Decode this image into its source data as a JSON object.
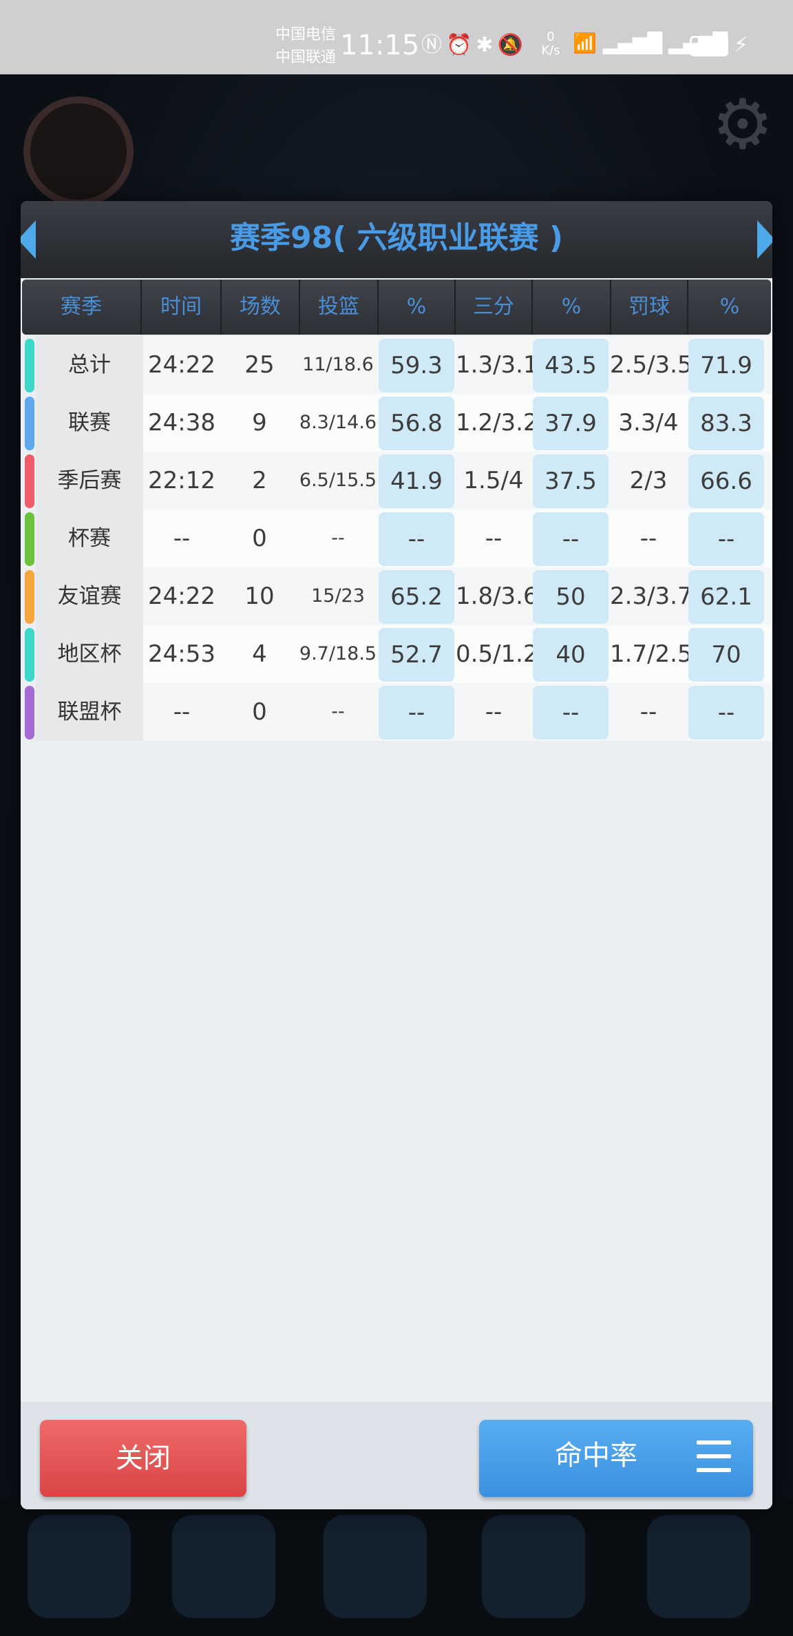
{
  "status_bar": {
    "carrier1": "中国电信",
    "carrier2": "中国联通",
    "time": "11:15",
    "net_speed_value": "0",
    "net_speed_unit": "K/s",
    "battery": "91",
    "icons": [
      "nfc-icon",
      "alarm-icon",
      "bluetooth-icon",
      "mute-icon",
      "wifi-icon",
      "signal-5g-icon",
      "signal-4g-icon",
      "charging-icon"
    ]
  },
  "modal": {
    "title": "赛季98( 六级职业联赛 )",
    "columns": [
      "赛季",
      "时间",
      "场数",
      "投篮",
      "%",
      "三分",
      "%",
      "罚球",
      "%"
    ],
    "rows": [
      {
        "label": "总计",
        "color": "#3ed6c8",
        "time": "24:22",
        "games": "25",
        "fg": "11/18.6",
        "fg_pct": "59.3",
        "three": "1.3/3.1",
        "three_pct": "43.5",
        "ft": "2.5/3.5",
        "ft_pct": "71.9"
      },
      {
        "label": "联赛",
        "color": "#5fa8ee",
        "time": "24:38",
        "games": "9",
        "fg": "8.3/14.6",
        "fg_pct": "56.8",
        "three": "1.2/3.2",
        "three_pct": "37.9",
        "ft": "3.3/4",
        "ft_pct": "83.3"
      },
      {
        "label": "季后赛",
        "color": "#ee5d6a",
        "time": "22:12",
        "games": "2",
        "fg": "6.5/15.5",
        "fg_pct": "41.9",
        "three": "1.5/4",
        "three_pct": "37.5",
        "ft": "2/3",
        "ft_pct": "66.6"
      },
      {
        "label": "杯赛",
        "color": "#6cc23c",
        "time": "--",
        "games": "0",
        "fg": "--",
        "fg_pct": "--",
        "three": "--",
        "three_pct": "--",
        "ft": "--",
        "ft_pct": "--"
      },
      {
        "label": "友谊赛",
        "color": "#f7a53e",
        "time": "24:22",
        "games": "10",
        "fg": "15/23",
        "fg_pct": "65.2",
        "three": "1.8/3.6",
        "three_pct": "50",
        "ft": "2.3/3.7",
        "ft_pct": "62.1"
      },
      {
        "label": "地区杯",
        "color": "#3ed6c8",
        "time": "24:53",
        "games": "4",
        "fg": "9.7/18.5",
        "fg_pct": "52.7",
        "three": "0.5/1.2",
        "three_pct": "40",
        "ft": "1.7/2.5",
        "ft_pct": "70"
      },
      {
        "label": "联盟杯",
        "color": "#a46ad6",
        "time": "--",
        "games": "0",
        "fg": "--",
        "fg_pct": "--",
        "three": "--",
        "three_pct": "--",
        "ft": "--",
        "ft_pct": "--"
      }
    ],
    "close_label": "关闭",
    "rate_label": "命中率"
  }
}
